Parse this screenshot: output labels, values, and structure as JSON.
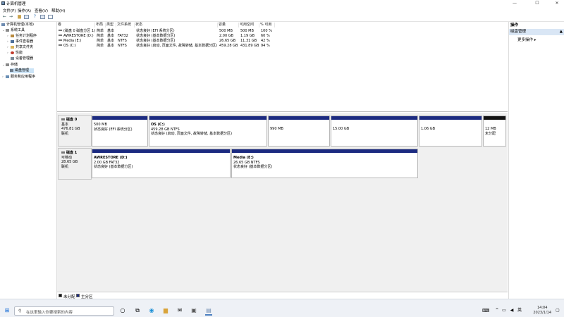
{
  "window": {
    "title": "计算机管理",
    "min": "—",
    "max": "☐",
    "close": "✕"
  },
  "menu": [
    "文件(F)",
    "操作(A)",
    "查看(V)",
    "帮助(H)"
  ],
  "tree": {
    "root": "计算机管理(本地)",
    "system_tools": "系统工具",
    "task_scheduler": "任务计划程序",
    "event_viewer": "事件查看器",
    "shared_folders": "共享文件夹",
    "performance": "性能",
    "device_manager": "设备管理器",
    "storage": "存储",
    "disk_management": "磁盘管理",
    "services": "服务和应用程序"
  },
  "volume_table": {
    "headers": [
      "卷",
      "布局",
      "类型",
      "文件系统",
      "状态",
      "容量",
      "可用空间",
      "% 可用"
    ],
    "rows": [
      [
        "(磁盘 0 磁盘分区 1)",
        "简单",
        "基本",
        "",
        "状态良好 (EFI 系统分区)",
        "500 MB",
        "500 MB",
        "100 %"
      ],
      [
        "AWRESTORE (D:)",
        "简单",
        "基本",
        "FAT32",
        "状态良好 (基本数据分区)",
        "2.00 GB",
        "1.19 GB",
        "60 %"
      ],
      [
        "Media (E:)",
        "简单",
        "基本",
        "NTFS",
        "状态良好 (基本数据分区)",
        "26.65 GB",
        "11.31 GB",
        "42 %"
      ],
      [
        "OS (C:)",
        "简单",
        "基本",
        "NTFS",
        "状态良好 (启动, 页面文件, 故障转储, 基本数据分区)",
        "459.28 GB",
        "431.89 GB",
        "94 %"
      ]
    ]
  },
  "disks": [
    {
      "name": "磁盘 0",
      "type": "基本",
      "size": "476.81 GB",
      "status": "联机",
      "parts": [
        {
          "name": "",
          "size": "500 MB",
          "status": "状态良好 (EFI 系统分区)"
        },
        {
          "name": "OS  (C:)",
          "size": "459.28 GB NTFS",
          "status": "状态良好 (启动, 页面文件, 故障转储, 基本数据分区)"
        },
        {
          "name": "",
          "size": "990 MB",
          "status": ""
        },
        {
          "name": "",
          "size": "15.00 GB",
          "status": ""
        },
        {
          "name": "",
          "size": "1.06 GB",
          "status": ""
        },
        {
          "name": "",
          "size": "12 MB",
          "status": "未分配"
        }
      ]
    },
    {
      "name": "磁盘 1",
      "type": "可移动",
      "size": "28.65 GB",
      "status": "联机",
      "parts": [
        {
          "name": "AWRESTORE  (D:)",
          "size": "2.00 GB FAT32",
          "status": "状态良好 (基本数据分区)"
        },
        {
          "name": "Media  (E:)",
          "size": "26.65 GB NTFS",
          "status": "状态良好 (基本数据分区)"
        }
      ]
    }
  ],
  "legend": {
    "unallocated": "未分配",
    "primary": "主分区"
  },
  "actions": {
    "header": "操作",
    "section": "磁盘管理",
    "more": "更多操作"
  },
  "taskbar": {
    "search_placeholder": "在这里输入你要搜索的内容",
    "time": "14:04",
    "date": "2023/1/14"
  },
  "colors": {
    "primary_partition": "#1b2a80",
    "unallocated": "#111111",
    "selection": "#cce4f7"
  }
}
